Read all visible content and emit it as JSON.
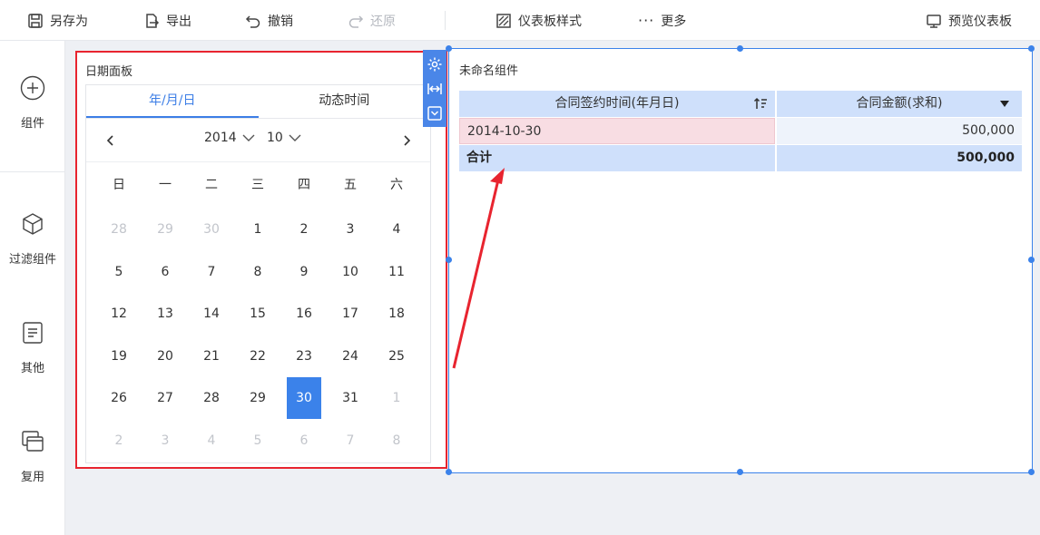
{
  "toolbar": {
    "save_as": "另存为",
    "export": "导出",
    "undo": "撤销",
    "redo": "还原",
    "dashboard_style": "仪表板样式",
    "more": "更多",
    "preview": "预览仪表板"
  },
  "sidebar": {
    "items": [
      {
        "label": "组件",
        "icon": "plus-circle-icon"
      },
      {
        "label": "过滤组件",
        "icon": "cube-icon"
      },
      {
        "label": "其他",
        "icon": "document-icon"
      },
      {
        "label": "复用",
        "icon": "copy-icon"
      }
    ]
  },
  "date_panel": {
    "title": "日期面板",
    "tabs": [
      "年/月/日",
      "动态时间"
    ],
    "active_tab": 0,
    "year": "2014",
    "month": "10",
    "weekdays": [
      "日",
      "一",
      "二",
      "三",
      "四",
      "五",
      "六"
    ],
    "weeks": [
      [
        "28",
        "29",
        "30",
        "1",
        "2",
        "3",
        "4"
      ],
      [
        "5",
        "6",
        "7",
        "8",
        "9",
        "10",
        "11"
      ],
      [
        "12",
        "13",
        "14",
        "15",
        "16",
        "17",
        "18"
      ],
      [
        "19",
        "20",
        "21",
        "22",
        "23",
        "24",
        "25"
      ],
      [
        "26",
        "27",
        "28",
        "29",
        "30",
        "31",
        "1"
      ],
      [
        "2",
        "3",
        "4",
        "5",
        "6",
        "7",
        "8"
      ]
    ],
    "muted": [
      [
        0,
        0
      ],
      [
        0,
        1
      ],
      [
        0,
        2
      ],
      [
        4,
        6
      ],
      [
        5,
        0
      ],
      [
        5,
        1
      ],
      [
        5,
        2
      ],
      [
        5,
        3
      ],
      [
        5,
        4
      ],
      [
        5,
        5
      ],
      [
        5,
        6
      ]
    ],
    "selected": [
      4,
      4
    ]
  },
  "table_widget": {
    "title": "未命名组件",
    "headers": [
      "合同签约时间(年月日)",
      "合同金额(求和)"
    ],
    "rows": [
      {
        "date": "2014-10-30",
        "amount": "500,000"
      }
    ],
    "total": {
      "label": "合计",
      "amount": "500,000"
    }
  },
  "colors": {
    "accent": "#3b82ea",
    "selection_border": "#e8242f",
    "header_bg": "#cfe0fb",
    "row_highlight": "#f8dde3"
  }
}
